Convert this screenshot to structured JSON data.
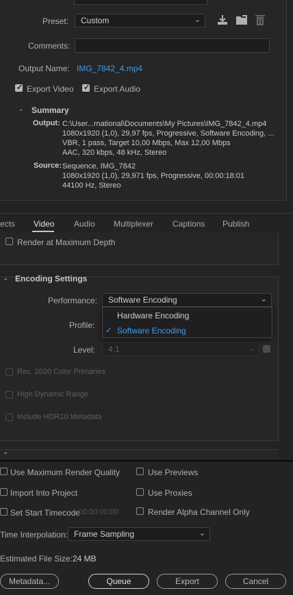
{
  "preset": {
    "label": "Preset:",
    "value": "Custom"
  },
  "comments": {
    "label": "Comments:",
    "value": ""
  },
  "output_name": {
    "label": "Output Name:",
    "value": "IMG_7842_4.mp4"
  },
  "export_video": {
    "label": "Export Video",
    "checked": true
  },
  "export_audio": {
    "label": "Export Audio",
    "checked": true
  },
  "summary": {
    "title": "Summary",
    "output_label": "Output:",
    "output_lines": [
      "C:\\User...rnational\\Documents\\My Pictures\\IMG_7842_4.mp4",
      "1080x1920 (1,0), 29,97 fps, Progressive, Software Encoding, ...",
      "VBR, 1 pass, Target 10,00 Mbps, Max 12,00 Mbps",
      "AAC, 320 kbps, 48 kHz, Stereo"
    ],
    "source_label": "Source:",
    "source_lines": [
      "Sequence, IMG_7842",
      "1080x1920 (1,0), 29,971 fps, Progressive, 00:00:18:01",
      "44100 Hz, Stereo"
    ]
  },
  "tabs": [
    "ects",
    "Video",
    "Audio",
    "Multiplexer",
    "Captions",
    "Publish"
  ],
  "active_tab": "Video",
  "render_max_depth": "Render at Maximum Depth",
  "encoding": {
    "title": "Encoding Settings",
    "performance_label": "Performance:",
    "performance_value": "Software Encoding",
    "dropdown_options": [
      "Hardware Encoding",
      "Software Encoding"
    ],
    "selected_option": "Software Encoding",
    "profile_label": "Profile:",
    "level_label": "Level:",
    "level_value": "4.1",
    "rec2020": "Rec. 2020 Color Primaries",
    "hdr": "High Dynamic Range",
    "hdr10": "Include HDR10 Metadata"
  },
  "bottom": {
    "max_render_quality": "Use Maximum Render Quality",
    "use_previews": "Use Previews",
    "import_into_project": "Import Into Project",
    "use_proxies": "Use Proxies",
    "set_start_timecode": "Set Start Timecode",
    "timecode_value": "00:00:00:00",
    "render_alpha": "Render Alpha Channel Only",
    "time_interp_label": "Time Interpolation:",
    "time_interp_value": "Frame Sampling",
    "file_size_label": "Estimated File Size:",
    "file_size_value": "24 MB",
    "buttons": {
      "metadata": "Metadata...",
      "queue": "Queue",
      "export": "Export",
      "cancel": "Cancel"
    }
  },
  "colors": {
    "accent": "#3f9bf0",
    "panel": "#262626",
    "background": "#232323"
  }
}
